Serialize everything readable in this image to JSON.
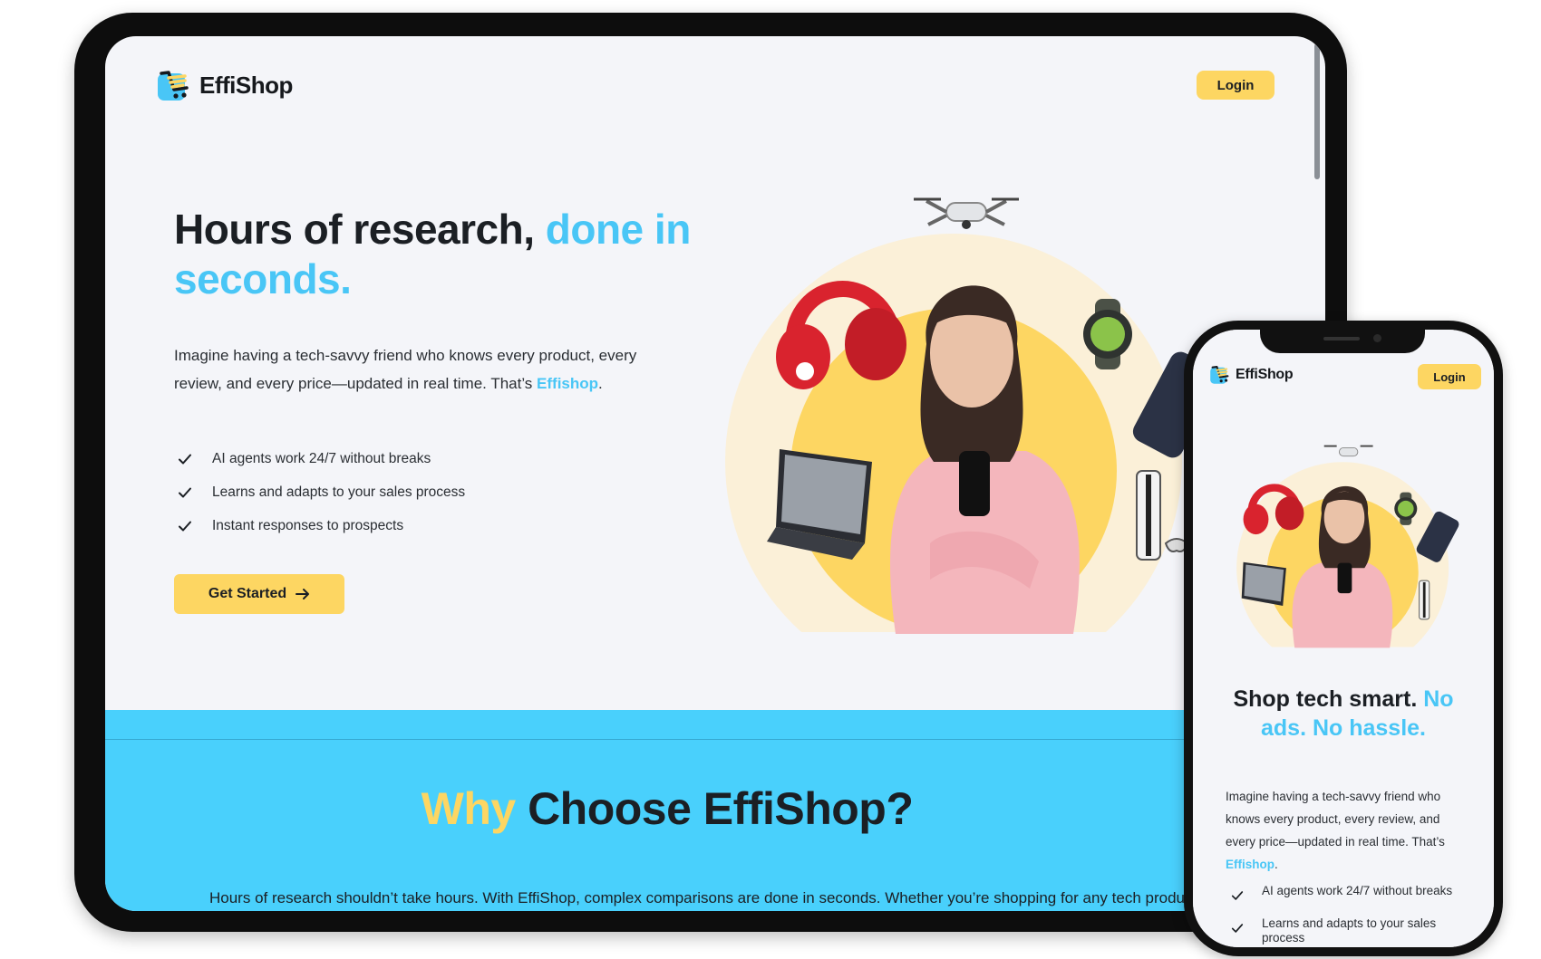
{
  "brand": {
    "name": "EffiShop"
  },
  "tablet": {
    "login_label": "Login",
    "hero": {
      "title_main": "Hours of research, ",
      "title_accent": "done in seconds.",
      "text_main": "Imagine having a tech-savvy friend who knows every product, every review, and every price—updated in real time. That’s ",
      "text_link": "Effishop",
      "text_end": ".",
      "features": [
        "AI agents work 24/7 without breaks",
        "Learns and adapts to your sales process",
        "Instant responses to prospects"
      ],
      "cta_label": "Get Started"
    },
    "why": {
      "title_accent": "Why",
      "title_main": " Choose EffiShop?",
      "text": "Hours of research shouldn’t take hours. With EffiShop, complex comparisons are done in seconds. Whether you’re shopping for any tech product"
    }
  },
  "phone": {
    "login_label": "Login",
    "title_main": "Shop tech smart. ",
    "title_accent": "No ads. No hassle.",
    "text_main": "Imagine having a tech-savvy friend who knows every product, every review, and every price—updated in real time. That’s ",
    "text_link": "Effishop",
    "text_end": ".",
    "features": [
      "AI agents work 24/7 without breaks",
      "Learns and adapts to your sales process"
    ]
  },
  "colors": {
    "accent_blue": "#49c6f6",
    "accent_yellow": "#fdd662",
    "section_blue": "#49d0fc",
    "background": "#f4f5f9"
  },
  "icons": [
    "logo-cart-icon",
    "check-icon",
    "arrow-right-icon",
    "drone-icon",
    "headphones-icon",
    "watch-icon",
    "phone-icon",
    "laptop-icon",
    "console-icon"
  ]
}
